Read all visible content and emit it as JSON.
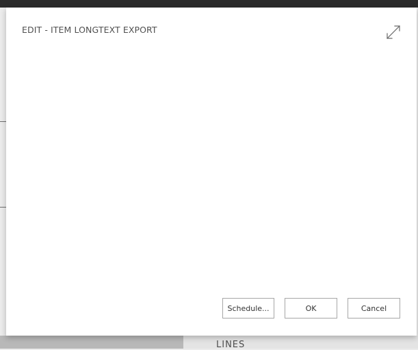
{
  "dialog": {
    "title": "EDIT - ITEM LONGTEXT EXPORT",
    "expand_icon": "expand-arrows-icon",
    "buttons": {
      "schedule": "Schedule...",
      "ok": "OK",
      "cancel": "Cancel"
    }
  },
  "background": {
    "section_label": "LINES"
  }
}
